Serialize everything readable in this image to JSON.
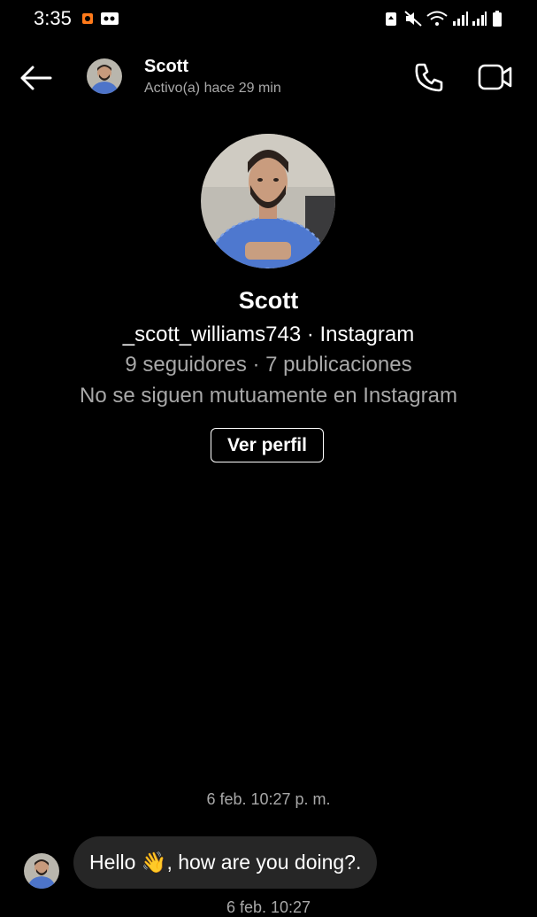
{
  "status_bar": {
    "time": "3:35"
  },
  "header": {
    "name": "Scott",
    "status": "Activo(a) hace 29 min"
  },
  "profile": {
    "name": "Scott",
    "handle_line": "_scott_williams743 · Instagram",
    "stats_line": "9 seguidores · 7 publicaciones",
    "mutual_line": "No se siguen mutuamente en Instagram",
    "view_profile_label": "Ver perfil"
  },
  "messages": {
    "date_1": "6 feb. 10:27 p. m.",
    "message_1": "Hello 👋,  how are you doing?.",
    "date_2": "6 feb. 10:27"
  },
  "colors": {
    "background": "#000000",
    "secondary_text": "#a8a8a8",
    "bubble": "#262626"
  }
}
